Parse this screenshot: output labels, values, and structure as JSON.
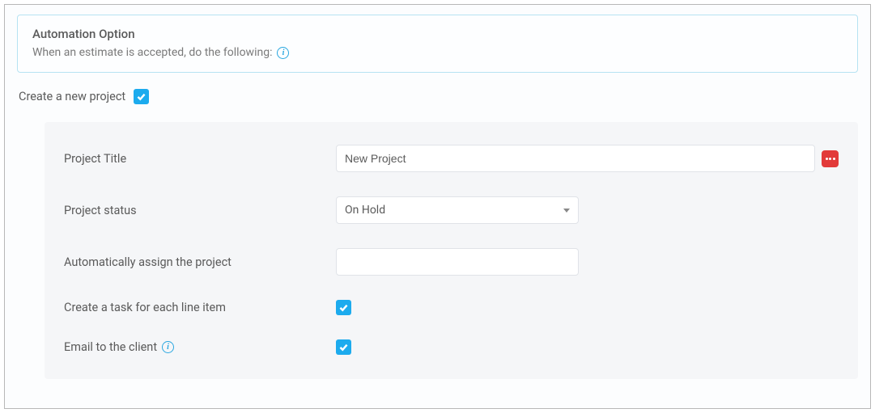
{
  "banner": {
    "title": "Automation Option",
    "subtitle": "When an estimate is accepted, do the following:"
  },
  "create_project": {
    "label": "Create a new project",
    "checked": true
  },
  "form": {
    "project_title": {
      "label": "Project Title",
      "value": "New Project"
    },
    "project_status": {
      "label": "Project status",
      "value": "On Hold"
    },
    "auto_assign": {
      "label": "Automatically assign the project",
      "value": ""
    },
    "create_task": {
      "label": "Create a task for each line item",
      "checked": true
    },
    "email_client": {
      "label": "Email to the client",
      "checked": true
    }
  }
}
